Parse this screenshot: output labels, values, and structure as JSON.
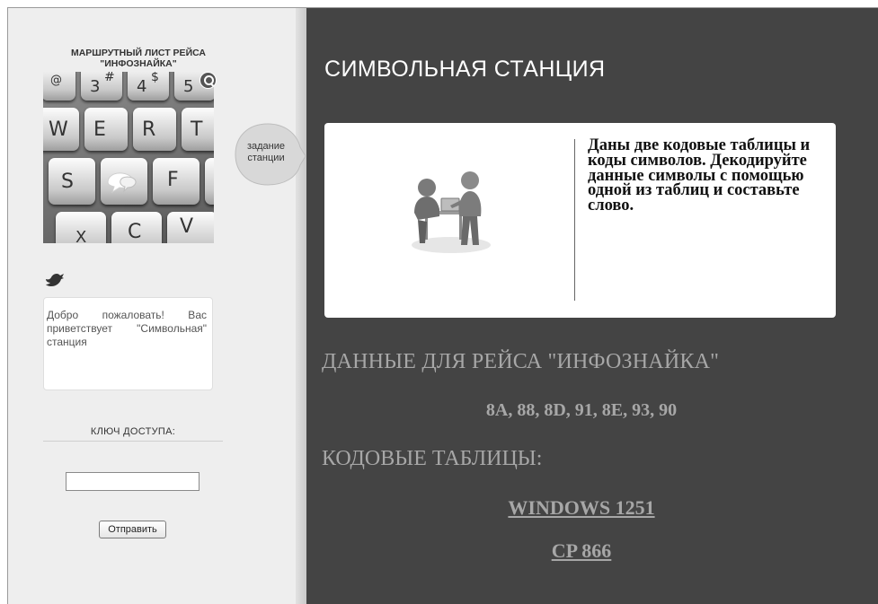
{
  "sidebar": {
    "route_title_line1": "МАРШРУТНЫЙ ЛИСТ РЕЙСА",
    "route_title_line2": "\"ИНФОЗНАЙКА\"",
    "keyboard_keys": {
      "r1": [
        "@",
        "3",
        "#",
        "4",
        "$",
        "5"
      ],
      "r2": [
        "W",
        "E",
        "R",
        "T"
      ],
      "r3": [
        "S",
        "F"
      ],
      "r4": [
        "X",
        "C",
        "V"
      ]
    },
    "task_tab_label_1": "задание",
    "task_tab_label_2": "станции",
    "welcome_text": "Добро пожаловать! Вас приветствует \"Символьная\" станция",
    "access_key_label": "КЛЮЧ ДОСТУПА:",
    "access_key_value": "",
    "submit_label": "Отправить"
  },
  "main": {
    "station_title": "СИМВОЛЬНАЯ СТАНЦИЯ",
    "task_text": "Даны две кодовые таблицы и коды символов. Декодируйте данные символы с помощью одной из таблиц и составьте слово.",
    "data_heading": "ДАННЫЕ ДЛЯ РЕЙСА \"ИНФОЗНАЙКА\"",
    "codes": "8A, 88, 8D, 91, 8E, 93, 90",
    "tables_heading": "КОДОВЫЕ ТАБЛИЦЫ:",
    "table_links": [
      "WINDOWS 1251",
      "CP 866"
    ]
  },
  "icons": [
    "search-icon",
    "chat-icon",
    "bird-icon",
    "meeting-people-icon"
  ],
  "colors": {
    "main_bg": "#444444",
    "sidebar_bg": "#eeeeee",
    "muted_text": "#a7a7a7"
  }
}
